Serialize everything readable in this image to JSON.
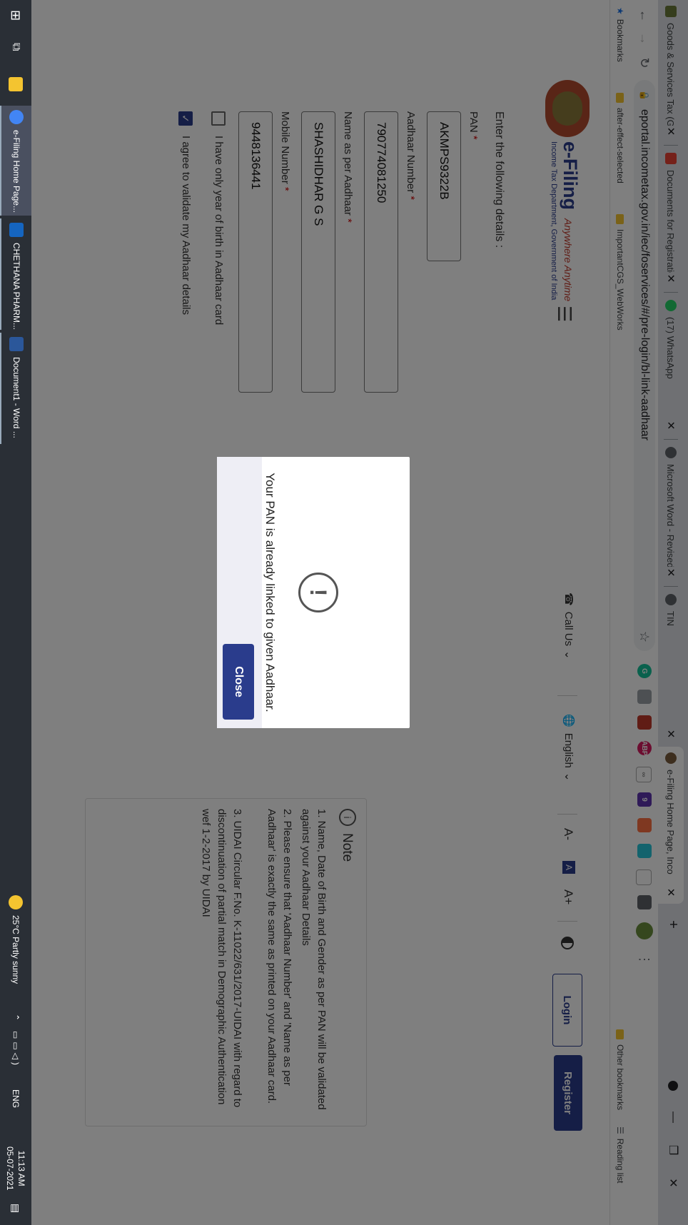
{
  "browser": {
    "tabs": [
      {
        "label": "Goods & Services Tax (GS",
        "fav": "#6b7b3a",
        "icon": "gst-emblem-icon"
      },
      {
        "label": "Documents for Registratio",
        "fav": "#ea4335",
        "icon": "gmail-icon"
      },
      {
        "label": "(17) WhatsApp",
        "fav": "#25d366",
        "icon": "whatsapp-icon"
      },
      {
        "label": "Microsoft Word - Revised",
        "fav": "#5f6368",
        "icon": "globe-icon"
      },
      {
        "label": "TIN",
        "fav": "#5f6368",
        "icon": "globe-icon"
      },
      {
        "label": "e-Filing Home Page, Inco",
        "fav": "#7b5c3c",
        "icon": "efiling-emblem-icon"
      }
    ],
    "new_tab": "+",
    "url": "eportal.incometax.gov.in/iec/foservices/#/pre-login/bl-link-aadhaar",
    "bookmarks": {
      "bookmarks_label": "Bookmarks",
      "items": [
        "after-effect-selected",
        "ImportantCGS_WebWorks"
      ],
      "other": "Other bookmarks",
      "reading": "Reading list"
    }
  },
  "header": {
    "logo_title": "e-Filing",
    "logo_tagline": "Anywhere Anytime",
    "logo_sub": "Income Tax Department, Government of India",
    "call_us": "Call Us",
    "language": "English",
    "font_minus": "A-",
    "font_default": "A",
    "font_plus": "A+",
    "login": "Login",
    "register": "Register"
  },
  "form": {
    "intro": "Enter the following details :",
    "pan_label": "PAN",
    "pan_value": "AKMPS9322B",
    "aadhaar_label": "Aadhaar Number",
    "aadhaar_value": "790774081250",
    "name_label": "Name as per Aadhaar",
    "name_value": "SHASHIDHAR G S",
    "mobile_label": "Mobile Number",
    "mobile_value": "9448136441",
    "req": "*",
    "yob_label": "I have only year of birth in Aadhaar card",
    "agree_label": "I agree to validate my Aadhaar details"
  },
  "note": {
    "title": "Note",
    "items": [
      "1. Name, Date of Birth and Gender as per PAN will be validated against your Aadhaar Details",
      "2. Please ensure that 'Aadhaar Number' and 'Name as per Aadhaar' is exactly the same as printed on your Aadhaar card.",
      "3. UIDAI Circular F.No. K-11022/631/2017-UIDAI with regard to discontinuation of partial match in Demographic Authentication wef 1-2-2017 by UIDAI"
    ]
  },
  "modal": {
    "message": "Your PAN is already linked to given Aadhaar.",
    "close": "Close"
  },
  "taskbar": {
    "apps": [
      {
        "label": "e-Filing Home Page...",
        "color": "#4285f4"
      },
      {
        "label": "CHETHANA PHARM...",
        "color": "#1565c0"
      },
      {
        "label": "Document1 - Word ...",
        "color": "#2b579a"
      }
    ],
    "weather": "25°C  Partly sunny",
    "lang": "ENG",
    "time": "11:13 AM",
    "date": "05-07-2021"
  },
  "colors": {
    "primary": "#2a3c8c",
    "required": "#cc0000"
  }
}
